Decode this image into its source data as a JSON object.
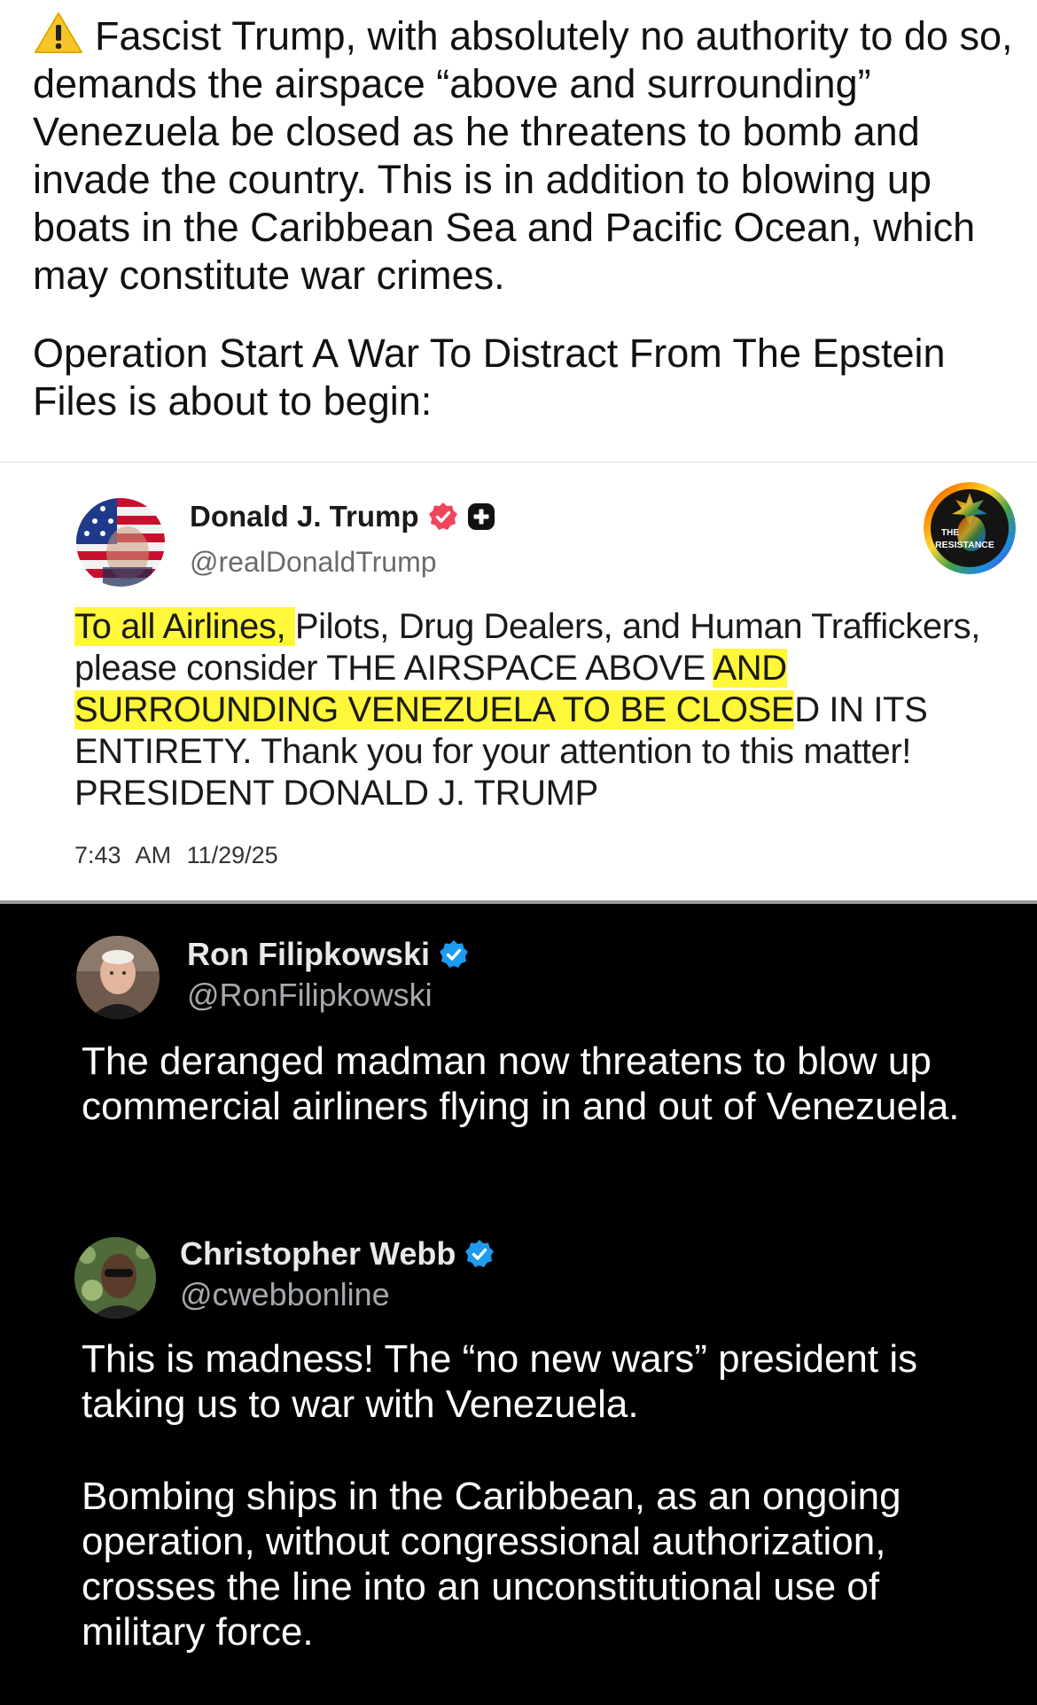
{
  "caption": {
    "warning_icon": "warning-icon",
    "paragraph1": "Fascist Trump, with absolutely no authority to do so, demands the airspace “above and surrounding” Venezuela be closed as he threatens to bomb and invade the country. This is in addition to blowing up boats in the Caribbean Sea and Pacific Ocean, which may constitute war crimes.",
    "paragraph2": "Operation Start A War To Distract From The Epstein Files is about to begin:"
  },
  "trump_post": {
    "name": "Donald J. Trump",
    "handle": "@realDonaldTrump",
    "badge_text_line1": "THE",
    "badge_text_line2": "RESISTANCE",
    "text_hl1": "To all Airlines, ",
    "text_part2": "Pilots, Drug Dealers, and Human Traffickers, please consider THE AIRSPACE ABOVE ",
    "text_hl2": "AND SURROUNDING VENEZUELA TO BE CLOSE",
    "text_part3": "D IN ITS ENTIRETY. Thank you for your attention to this matter! PRESIDENT DONALD J. TRUMP",
    "time": "7:43 AM",
    "date": "11/29/25",
    "highlight_color": "#fff73a"
  },
  "ron_post": {
    "name": "Ron Filipkowski",
    "handle": "@RonFilipkowski",
    "text": "The deranged madman now threatens to blow up commercial airliners flying in and out of Venezuela."
  },
  "webb_post": {
    "name": "Christopher Webb",
    "handle": "@cwebbonline",
    "text_p1": "This is madness! The “no new wars” president is taking us to war with Venezuela.",
    "text_p2": "Bombing ships in the Caribbean, as an ongoing operation, without congressional authorization, crosses the line into an unconstitutional use of military force."
  },
  "colors": {
    "verified_blue": "#1d9bf0",
    "truth_badge_red": "#f0455a",
    "dark_bg": "#000000"
  }
}
